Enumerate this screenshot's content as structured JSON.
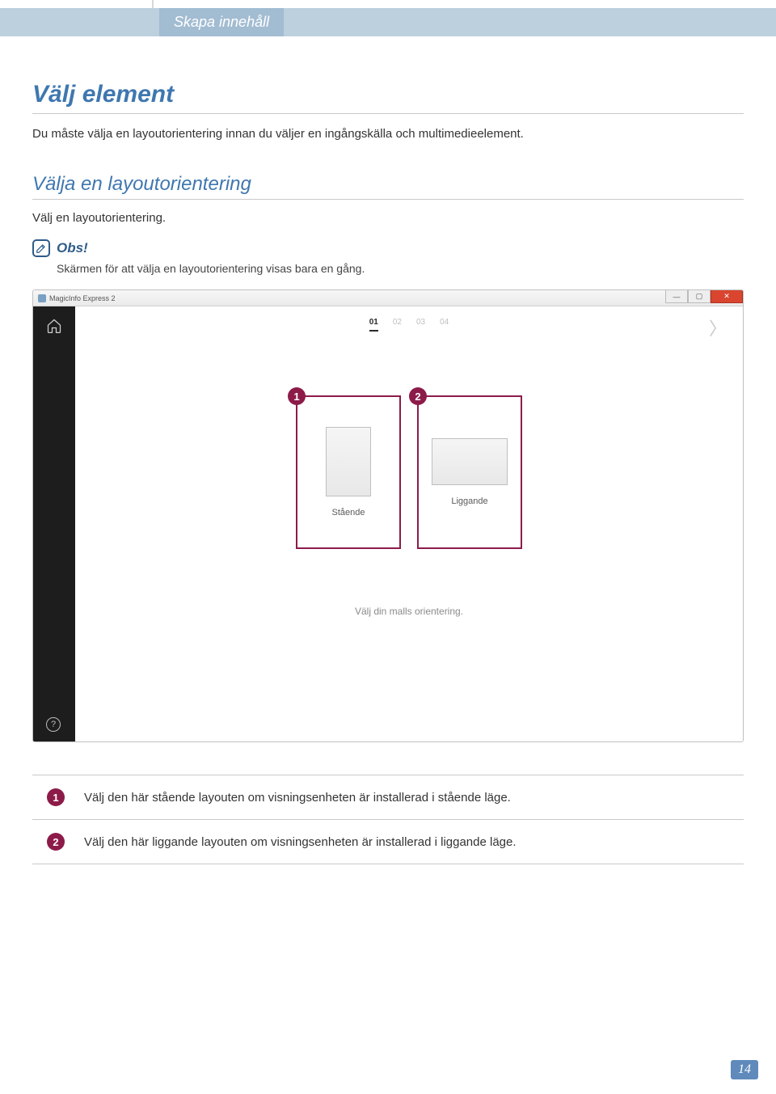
{
  "banner": {
    "title": "Skapa innehåll"
  },
  "section": {
    "heading": "Välj element",
    "intro": "Du måste välja en layoutorientering innan du väljer en ingångskälla och multimedieelement."
  },
  "subsection": {
    "heading": "Välja en layoutorientering",
    "intro": "Välj en layoutorientering.",
    "obs_label": "Obs!",
    "obs_text": "Skärmen för att välja en layoutorientering visas bara en gång."
  },
  "app": {
    "title": "MagicInfo Express 2",
    "steps": [
      "01",
      "02",
      "03",
      "04"
    ],
    "active_step": 0,
    "help": "?",
    "next": "〉",
    "orientation": {
      "portrait_label": "Stående",
      "landscape_label": "Liggande",
      "callout1": "1",
      "callout2": "2"
    },
    "hint": "Välj din malls orientering."
  },
  "legend": {
    "items": [
      {
        "num": "1",
        "text": "Välj den här stående layouten om visningsenheten är installerad i stående läge."
      },
      {
        "num": "2",
        "text": "Välj den här liggande layouten om visningsenheten är installerad i liggande läge."
      }
    ]
  },
  "page_number": "14"
}
